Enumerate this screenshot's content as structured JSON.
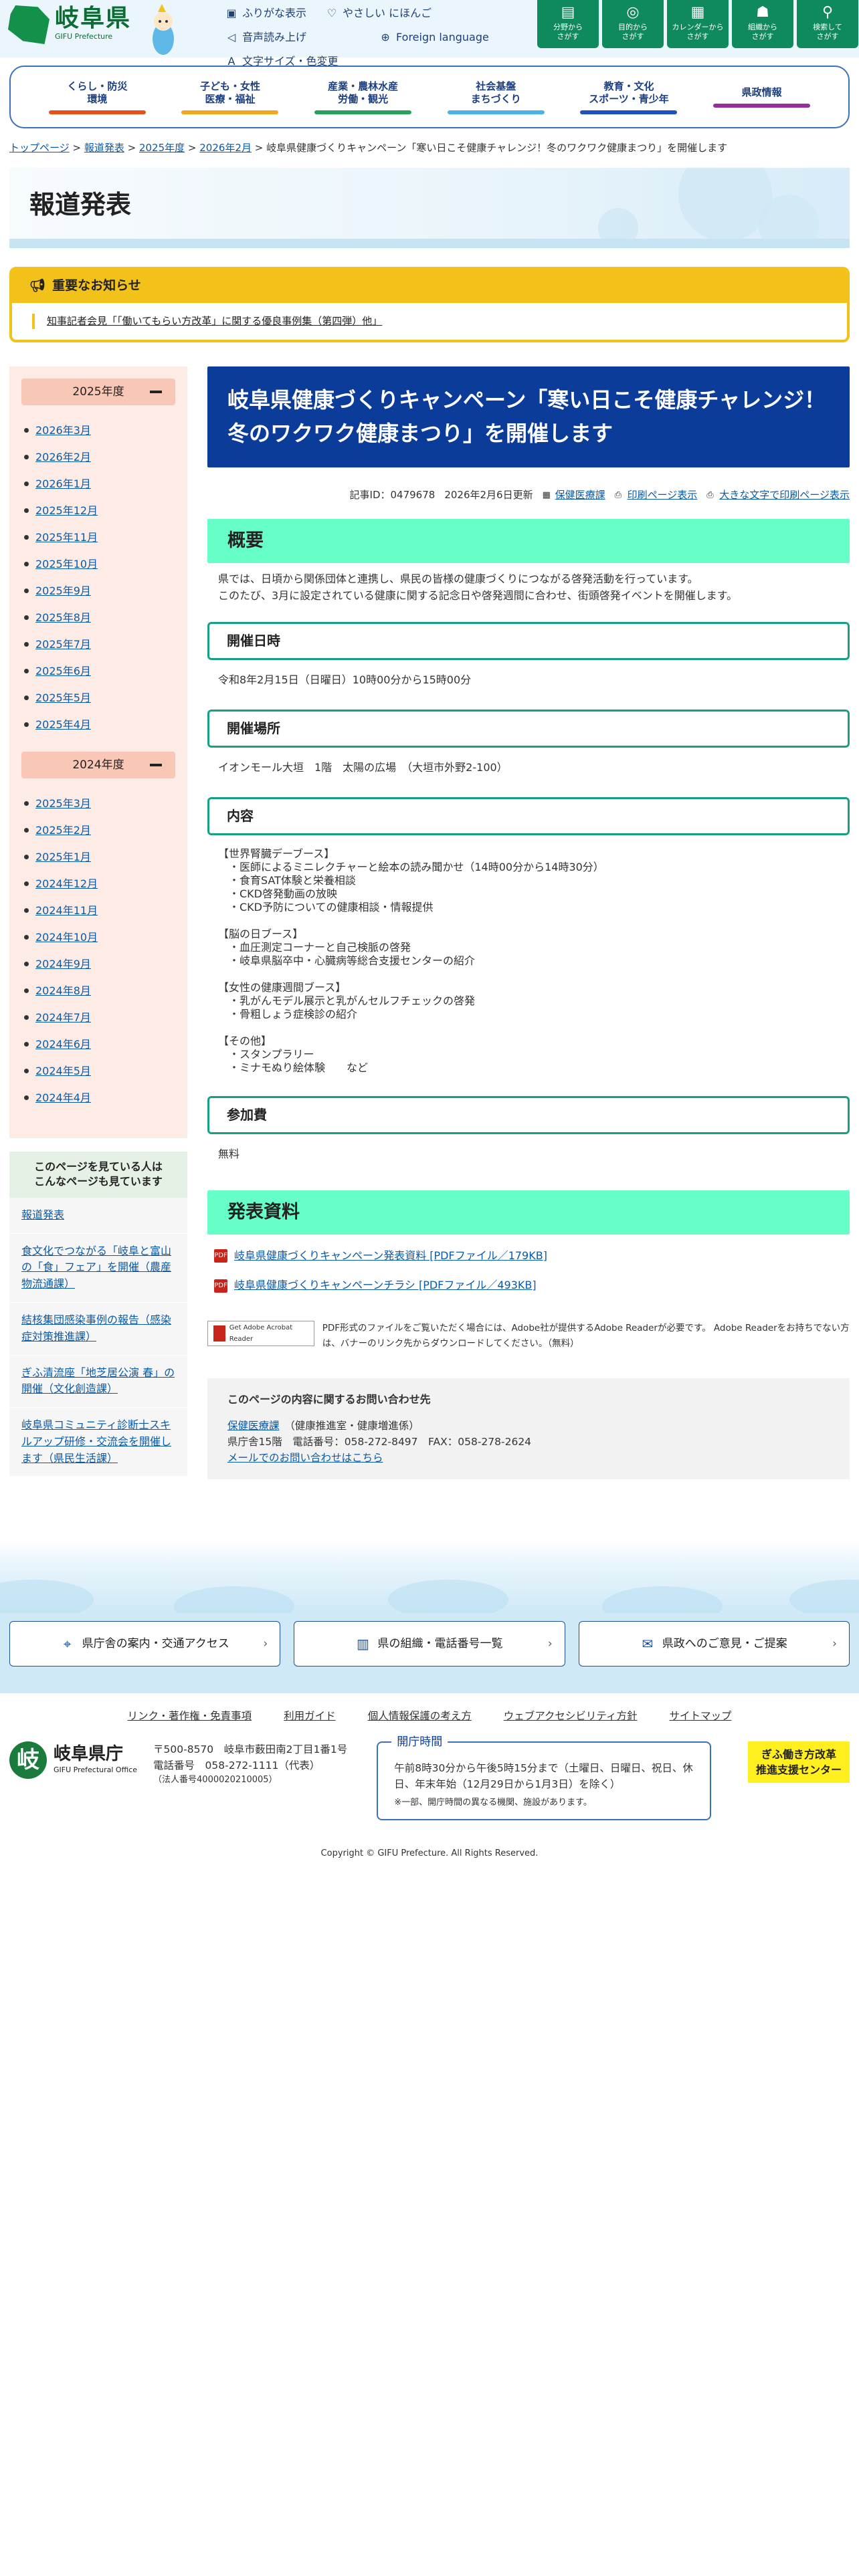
{
  "header": {
    "logo_name": "岐阜県",
    "logo_en": "GIFU Prefecture",
    "utility": [
      {
        "icon": "furigana-icon",
        "label": "ふりがな表示"
      },
      {
        "icon": "heart-icon",
        "label": "やさしい にほんご"
      },
      {
        "icon": "speaker-icon",
        "label": "音声読み上げ"
      },
      {
        "icon": "globe-icon",
        "label": "Foreign language"
      },
      {
        "icon": "text-size-icon",
        "label": "文字サイズ・色変更"
      }
    ],
    "tiles": [
      {
        "icon": "book-icon",
        "l1": "分野から",
        "l2": "さがす"
      },
      {
        "icon": "target-icon",
        "l1": "目的から",
        "l2": "さがす"
      },
      {
        "icon": "calendar-icon",
        "l1": "カレンダーから",
        "l2": "さがす"
      },
      {
        "icon": "people-icon",
        "l1": "組織から",
        "l2": "さがす"
      },
      {
        "icon": "search-icon",
        "l1": "検索して",
        "l2": "さがす"
      }
    ]
  },
  "gnav": [
    {
      "l1": "くらし・防災",
      "l2": "環境",
      "color": "#e9501a"
    },
    {
      "l1": "子ども・女性",
      "l2": "医療・福祉",
      "color": "#f2a81c"
    },
    {
      "l1": "産業・農林水産",
      "l2": "労働・観光",
      "color": "#29a15b"
    },
    {
      "l1": "社会基盤",
      "l2": "まちづくり",
      "color": "#4fb2e6"
    },
    {
      "l1": "教育・文化",
      "l2": "スポーツ・青少年",
      "color": "#1f4fc5"
    },
    {
      "l1": "県政情報",
      "l2": "",
      "color": "#962d9c"
    }
  ],
  "breadcrumb": {
    "items": [
      "トップページ",
      "報道発表",
      "2025年度",
      "2026年2月"
    ],
    "current": "岐阜県健康づくりキャンペーン「寒い日こそ健康チャレンジ！冬のワクワク健康まつり」を開催します"
  },
  "page_title": "報道発表",
  "notice": {
    "heading": "重要なお知らせ",
    "link": "知事記者会見「「働いてもらい方改革」に関する優良事例集（第四弾）他」"
  },
  "archive": [
    {
      "year": "2025年度",
      "months": [
        "2026年3月",
        "2026年2月",
        "2026年1月",
        "2025年12月",
        "2025年11月",
        "2025年10月",
        "2025年9月",
        "2025年8月",
        "2025年7月",
        "2025年6月",
        "2025年5月",
        "2025年4月"
      ]
    },
    {
      "year": "2024年度",
      "months": [
        "2025年3月",
        "2025年2月",
        "2025年1月",
        "2024年12月",
        "2024年11月",
        "2024年10月",
        "2024年9月",
        "2024年8月",
        "2024年7月",
        "2024年6月",
        "2024年5月",
        "2024年4月"
      ]
    }
  ],
  "related": {
    "heading": "このページを見ている人は\nこんなページも見ています",
    "items": [
      "報道発表",
      "食文化でつながる「岐阜と富山の「食」フェア」を開催（農産物流通課）",
      "結核集団感染事例の報告（感染症対策推進課）",
      "ぎふ清流座「地芝居公演 春」の開催（文化創造課）",
      "岐阜県コミュニティ診断士スキルアップ研修・交流会を開催します（県民生活課）"
    ]
  },
  "article": {
    "title": "岐阜県健康づくりキャンペーン「寒い日こそ健康チャレンジ！冬のワクワク健康まつり」を開催します",
    "record_id": "記事ID：0479678",
    "updated": "2026年2月6日更新",
    "dept_link": "保健医療課",
    "print": "印刷ページ表示",
    "print_large": "大きな文字で印刷ページ表示",
    "overview_h": "概要",
    "overview": "県では、日頃から関係団体と連携し、県民の皆様の健康づくりにつながる啓発活動を行っています。\nこのたび、3月に設定されている健康に関する記念日や啓発週間に合わせ、街頭啓発イベントを開催します。",
    "date_h": "開催日時",
    "date": "令和8年2月15日（日曜日）10時00分から15時00分",
    "place_h": "開催場所",
    "place": "イオンモール大垣　1階　太陽の広場　（大垣市外野2-100）",
    "content_h": "内容",
    "content": "【世界腎臓デーブース】\n　・医師によるミニレクチャーと絵本の読み聞かせ（14時00分から14時30分）\n　・食育SAT体験と栄養相談\n　・CKD啓発動画の放映\n　・CKD予防についての健康相談・情報提供\n\n【脳の日ブース】\n　・血圧測定コーナーと自己検脈の啓発\n　・岐阜県脳卒中・心臓病等総合支援センターの紹介\n\n【女性の健康週間ブース】\n　・乳がんモデル展示と乳がんセルフチェックの啓発\n　・骨粗しょう症検診の紹介\n\n【その他】\n　・スタンプラリー\n　・ミナモぬり絵体験　　など",
    "fee_h": "参加費",
    "fee": "無料",
    "materials_h": "発表資料",
    "materials": [
      "岐阜県健康づくりキャンペーン発表資料 [PDFファイル／179KB]",
      "岐阜県健康づくりキャンペーンチラシ [PDFファイル／493KB]"
    ],
    "acrobat_badge": "Get Adobe Acrobat Reader",
    "acrobat_note": "PDF形式のファイルをご覧いただく場合には、Adobe社が提供するAdobe Readerが必要です。 Adobe Readerをお持ちでない方は、バナーのリンク先からダウンロードしてください。（無料）",
    "contact": {
      "heading": "このページの内容に関するお問い合わせ先",
      "dept": "保健医療課",
      "sub": "（健康推進室・健康増進係）",
      "tel": "県庁舎15階　電話番号：058-272-8497　FAX：058-278-2624",
      "mail": "メールでのお問い合わせはこちら"
    }
  },
  "footer": {
    "buttons": [
      {
        "icon": "pin-icon",
        "label": "県庁舎の案内・交通アクセス"
      },
      {
        "icon": "building-icon",
        "label": "県の組織・電話番号一覧"
      },
      {
        "icon": "chat-icon",
        "label": "県政へのご意見・ご提案"
      }
    ],
    "links": [
      "リンク・著作権・免責事項",
      "利用ガイド",
      "個人情報保護の考え方",
      "ウェブアクセシビリティ方針",
      "サイトマップ"
    ],
    "org_name": "岐阜県庁",
    "org_en": "GIFU Prefectural Office",
    "address": "〒500-8570　岐阜市薮田南2丁目1番1号",
    "phone": "電話番号　058-272-1111（代表）",
    "corp_no": "（法人番号4000020210005）",
    "hours_label": "開庁時間",
    "hours": "午前8時30分から午後5時15分まで（土曜日、日曜日、祝日、休日、年末年始（12月29日から1月3日）を除く）",
    "hours_note": "※一部、開庁時間の異なる機関、施設があります。",
    "support": "ぎふ働き方改革\n推進支援センター",
    "copyright": "Copyright © GIFU Prefecture. All Rights Reserved."
  }
}
